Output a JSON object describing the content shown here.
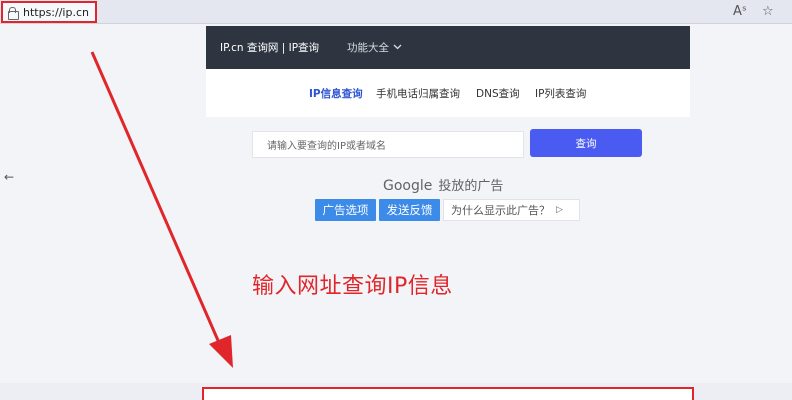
{
  "browser": {
    "url": "https://ip.cn",
    "read_aloud_icon": "Aˢ",
    "favorite_icon": "☆"
  },
  "header": {
    "brand": "IP.cn 查询网 | IP查询",
    "menu_label": "功能大全",
    "menu_icon": "⌄"
  },
  "nav": {
    "items": [
      "IP信息查询",
      "手机电话归属查询",
      "DNS查询",
      "IP列表查询"
    ],
    "active": "IP信息查询"
  },
  "search": {
    "placeholder": "请输入要查询的IP或者域名",
    "button_label": "查询"
  },
  "ad": {
    "google": "Google",
    "served_text": "投放的广告",
    "ad_options": "广告选项",
    "send_feedback": "发送反馈",
    "why_this_ad": "为什么显示此广告？",
    "why_icon": "▷"
  },
  "annotation": {
    "text": "输入网址查询IP信息",
    "color": "#e0262a"
  },
  "colors": {
    "accent": "#4a5bf2",
    "header_bg": "#2e3540",
    "ad_button": "#3d8be8",
    "highlight": "#e0262a"
  },
  "back_icon": "←"
}
